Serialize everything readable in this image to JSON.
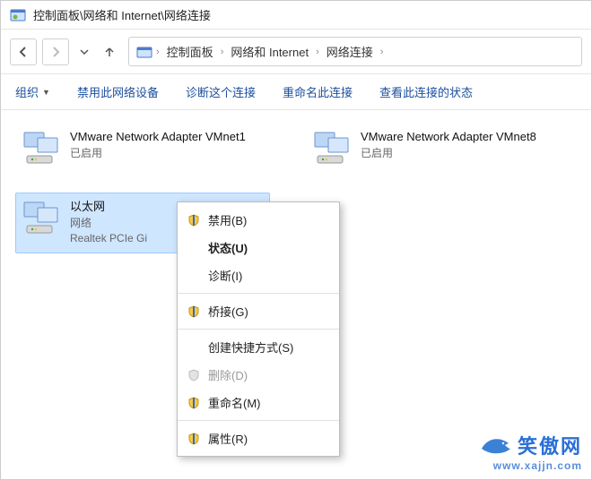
{
  "titlebar": {
    "title": "控制面板\\网络和 Internet\\网络连接"
  },
  "breadcrumb": {
    "items": [
      "控制面板",
      "网络和 Internet",
      "网络连接"
    ]
  },
  "toolbar": {
    "organize": "组织",
    "disable": "禁用此网络设备",
    "diagnose": "诊断这个连接",
    "rename": "重命名此连接",
    "status": "查看此连接的状态"
  },
  "adapters": [
    {
      "name": "VMware Network Adapter VMnet1",
      "status": "已启用",
      "detail": ""
    },
    {
      "name": "VMware Network Adapter VMnet8",
      "status": "已启用",
      "detail": ""
    },
    {
      "name": "以太网",
      "status": "网络",
      "detail": "Realtek PCIe Gi"
    }
  ],
  "contextMenu": {
    "disable": "禁用(B)",
    "status": "状态(U)",
    "diagnose": "诊断(I)",
    "bridge": "桥接(G)",
    "shortcut": "创建快捷方式(S)",
    "delete": "删除(D)",
    "rename": "重命名(M)",
    "properties": "属性(R)"
  },
  "watermark": {
    "name": "笑傲网",
    "url": "www.xajjn.com"
  }
}
